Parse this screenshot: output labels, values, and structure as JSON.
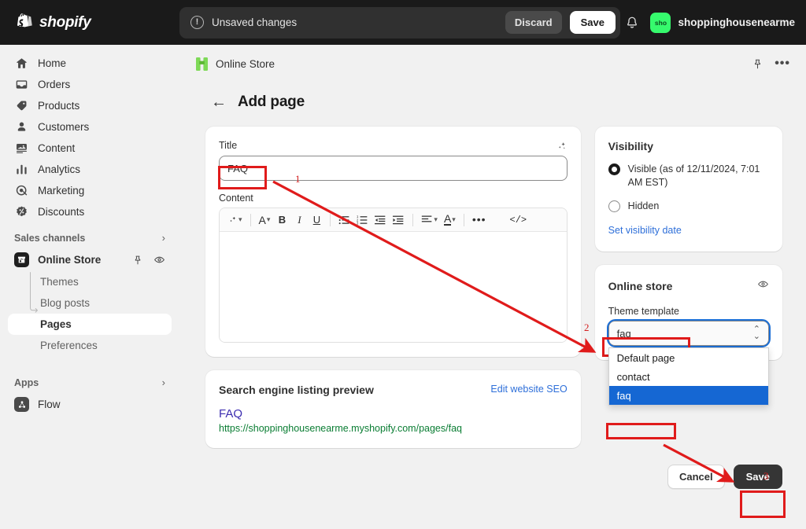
{
  "topbar": {
    "brand": "shopify",
    "savebar": {
      "icon": "alert-circle-icon",
      "label": "Unsaved changes",
      "discard_label": "Discard",
      "save_label": "Save"
    },
    "notifications_icon": "bell-icon",
    "user": {
      "avatar_initials": "sho",
      "name": "shoppinghousenearme"
    }
  },
  "sidebar": {
    "items": [
      {
        "label": "Home",
        "icon": "home-icon"
      },
      {
        "label": "Orders",
        "icon": "orders-inbox-icon"
      },
      {
        "label": "Products",
        "icon": "product-tag-icon"
      },
      {
        "label": "Customers",
        "icon": "person-icon"
      },
      {
        "label": "Content",
        "icon": "content-image-icon"
      },
      {
        "label": "Analytics",
        "icon": "bar-chart-icon"
      },
      {
        "label": "Marketing",
        "icon": "target-icon"
      },
      {
        "label": "Discounts",
        "icon": "discount-badge-icon"
      }
    ],
    "sales_channels": {
      "title": "Sales channels",
      "chevron": "chevron-right-icon",
      "store": {
        "label": "Online Store",
        "icon": "storefront-icon",
        "pin_icon": "pin-icon",
        "view_icon": "eye-icon"
      },
      "sub_items": [
        {
          "label": "Themes",
          "active": false
        },
        {
          "label": "Blog posts",
          "active": false
        },
        {
          "label": "Pages",
          "active": true
        },
        {
          "label": "Preferences",
          "active": false
        }
      ]
    },
    "apps": {
      "title": "Apps",
      "chevron": "chevron-right-icon",
      "items": [
        {
          "label": "Flow",
          "icon": "flow-icon"
        }
      ]
    }
  },
  "content_header": {
    "icon": "online-store-app-icon",
    "title": "Online Store",
    "pin_icon": "pin-icon",
    "more_icon": "ellipsis-icon"
  },
  "page": {
    "back_icon": "arrow-left-icon",
    "title": "Add page"
  },
  "title_card": {
    "label": "Title",
    "magic_icon": "sparkle-magic-icon",
    "value": "FAQ",
    "placeholder": "",
    "content_label": "Content",
    "toolbar": [
      {
        "name": "magic-tool",
        "glyph": "✧",
        "chevron": true
      },
      {
        "name": "separator"
      },
      {
        "name": "font-size",
        "glyph": "A",
        "chevron": true
      },
      {
        "name": "bold",
        "glyph": "B"
      },
      {
        "name": "italic",
        "glyph": "I"
      },
      {
        "name": "underline",
        "glyph": "U"
      },
      {
        "name": "separator"
      },
      {
        "name": "bulleted-list",
        "glyph": "list-bullet"
      },
      {
        "name": "numbered-list",
        "glyph": "list-number"
      },
      {
        "name": "outdent",
        "glyph": "outdent"
      },
      {
        "name": "indent",
        "glyph": "indent"
      },
      {
        "name": "separator"
      },
      {
        "name": "align",
        "glyph": "align",
        "chevron": true
      },
      {
        "name": "text-color",
        "glyph": "A-underline",
        "chevron": true
      },
      {
        "name": "separator"
      },
      {
        "name": "more",
        "glyph": "…"
      },
      {
        "name": "html-code",
        "glyph": "</>"
      }
    ]
  },
  "seo_card": {
    "title": "Search engine listing preview",
    "edit_link": "Edit website SEO",
    "preview_title": "FAQ",
    "preview_url": "https://shoppinghousenearme.myshopify.com/pages/faq"
  },
  "visibility_card": {
    "title": "Visibility",
    "options": [
      {
        "label": "Visible (as of 12/11/2024, 7:01 AM EST)",
        "selected": true
      },
      {
        "label": "Hidden",
        "selected": false
      }
    ],
    "set_date_link": "Set visibility date"
  },
  "online_store_card": {
    "title": "Online store",
    "eye_icon": "eye-icon",
    "field_label": "Theme template",
    "selected_value": "faq",
    "caret_icon": "chevron-updown-icon",
    "options": [
      {
        "label": "Default page",
        "selected": false
      },
      {
        "label": "contact",
        "selected": false
      },
      {
        "label": "faq",
        "selected": true
      }
    ]
  },
  "footer": {
    "cancel_label": "Cancel",
    "save_label": "Save"
  },
  "annotations": {
    "color": "#e01b1b",
    "steps": [
      {
        "number": "1",
        "target": "title-input"
      },
      {
        "number": "2",
        "target": "theme-template-field"
      },
      {
        "number": "3",
        "target": "save-button"
      }
    ]
  }
}
